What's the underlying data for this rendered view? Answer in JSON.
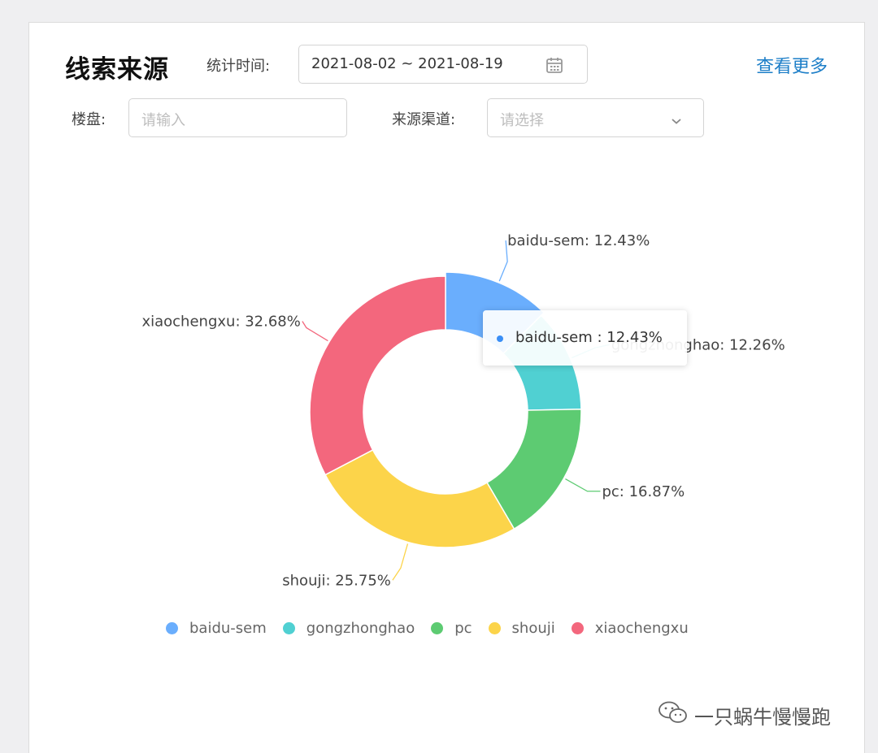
{
  "header": {
    "title": "线索来源",
    "more_link": "查看更多"
  },
  "filters": {
    "time_label": "统计时间:",
    "date_range": "2021-08-02 ~ 2021-08-19",
    "building_label": "楼盘:",
    "building_placeholder": "请输入",
    "channel_label": "来源渠道:",
    "channel_placeholder": "请选择"
  },
  "tooltip": {
    "text": "baidu-sem : 12.43%",
    "color": "#3a8ef6"
  },
  "watermark": {
    "text": "一只蜗牛慢慢跑"
  },
  "chart_data": {
    "type": "pie",
    "donut": true,
    "title": "",
    "categories": [
      "baidu-sem",
      "gongzhonghao",
      "pc",
      "shouji",
      "xiaochengxu"
    ],
    "values": [
      12.43,
      12.26,
      16.87,
      25.75,
      32.68
    ],
    "unit": "%",
    "colors": [
      "#6aaefd",
      "#50d0d2",
      "#5dcb72",
      "#fcd44a",
      "#f3677d"
    ],
    "labels": [
      "baidu-sem: 12.43%",
      "gongzhonghao: 12.26%",
      "pc: 16.87%",
      "shouji: 25.75%",
      "xiaochengxu: 32.68%"
    ],
    "legend_position": "bottom",
    "highlighted": "baidu-sem"
  }
}
